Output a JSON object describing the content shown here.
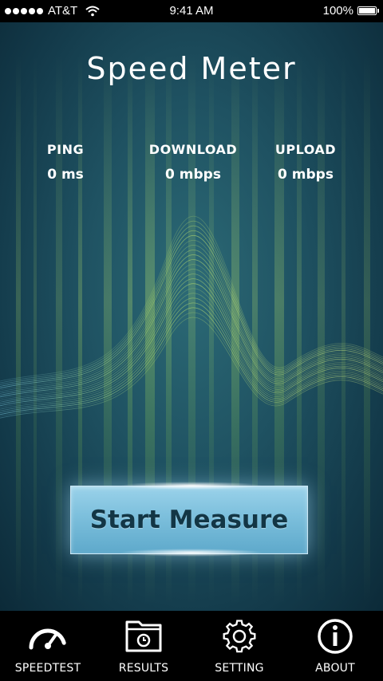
{
  "status_bar": {
    "carrier": "AT&T",
    "time": "9:41 AM",
    "battery": "100%"
  },
  "app": {
    "title": "Speed Meter"
  },
  "stats": {
    "ping": {
      "label": "PING",
      "value": "0 ms"
    },
    "download": {
      "label": "DOWNLOAD",
      "value": "0 mbps"
    },
    "upload": {
      "label": "UPLOAD",
      "value": "0 mbps"
    }
  },
  "start_button": {
    "label": "Start Measure"
  },
  "tabs": [
    {
      "label": "SPEEDTEST",
      "icon": "speedometer-icon"
    },
    {
      "label": "RESULTS",
      "icon": "results-folder-icon"
    },
    {
      "label": "SETTING",
      "icon": "gear-icon"
    },
    {
      "label": "ABOUT",
      "icon": "info-icon"
    }
  ],
  "colors": {
    "background": "#1f5262",
    "button": "#7cbfdc",
    "button_text": "#133645",
    "wave": "#b8e06a",
    "tab_bar": "#000000"
  }
}
